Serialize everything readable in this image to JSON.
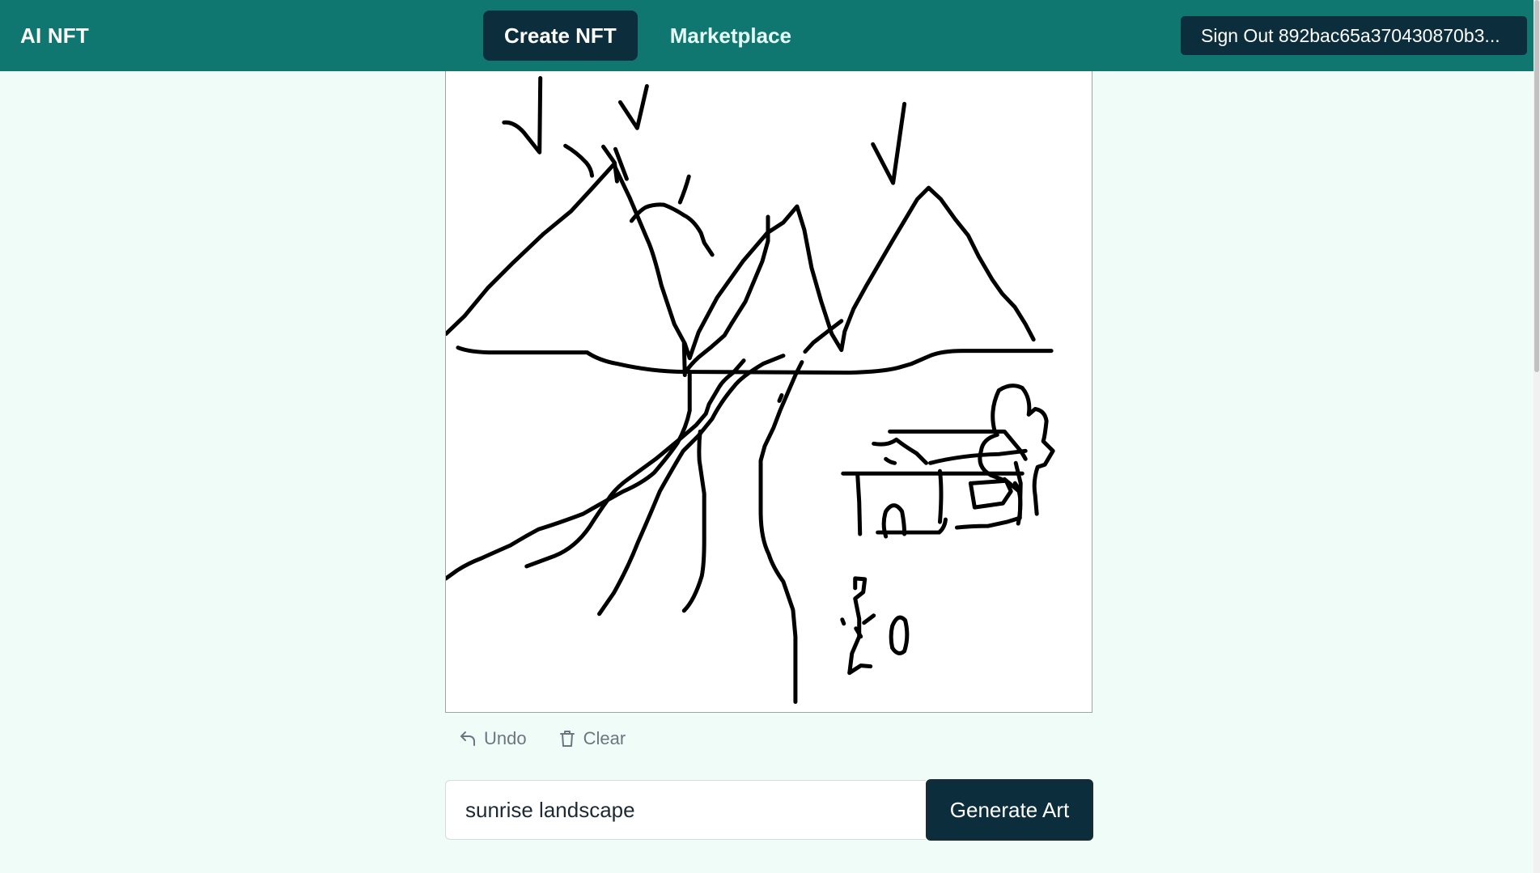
{
  "app": {
    "brand": "AI NFT"
  },
  "nav": {
    "items": [
      {
        "label": "Create NFT",
        "active": true
      },
      {
        "label": "Marketplace",
        "active": false
      }
    ],
    "signout_label": "Sign Out 892bac65a370430870b3..."
  },
  "canvas": {
    "undo_label": "Undo",
    "clear_label": "Clear",
    "undo_icon": "undo-icon",
    "clear_icon": "trash-icon"
  },
  "prompt": {
    "value": "sunrise landscape",
    "generate_label": "Generate Art"
  },
  "colors": {
    "header_bg": "#0f7670",
    "dark_button": "#0c2e3c",
    "page_bg": "#effcf8"
  }
}
